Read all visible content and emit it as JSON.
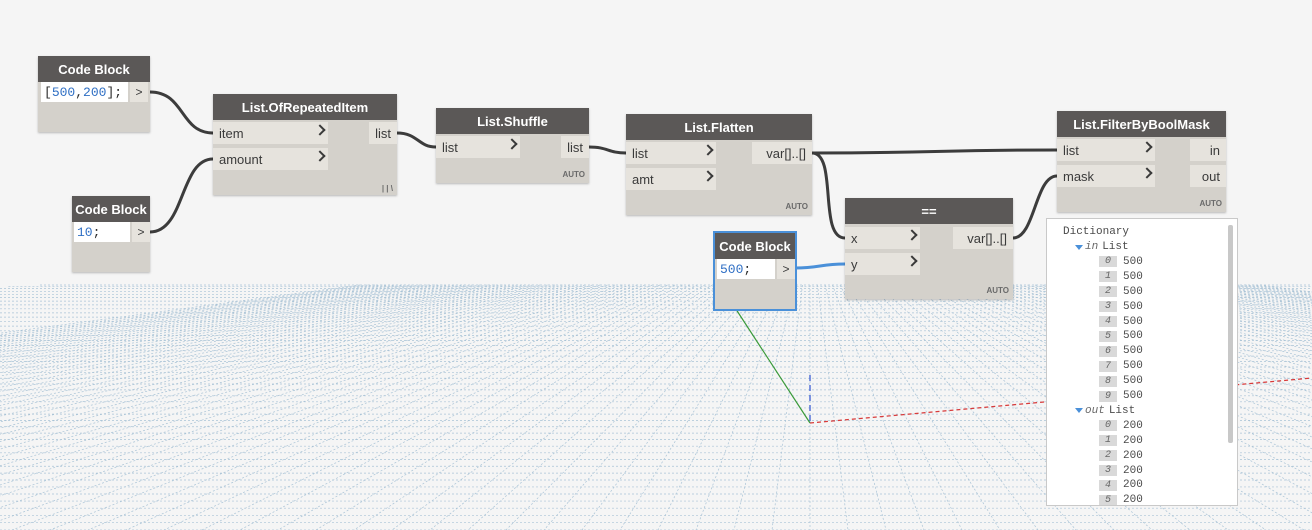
{
  "nodes": {
    "cb1": {
      "title": "Code Block",
      "code_open": "[",
      "code_a": "500",
      "code_sep": ",",
      "code_b": "200",
      "code_close": "];",
      "out": ">"
    },
    "cb2": {
      "title": "Code Block",
      "code_num": "10",
      "code_end": ";",
      "out": ">"
    },
    "cb3": {
      "title": "Code Block",
      "code_num": "500",
      "code_end": ";",
      "out": ">"
    },
    "repeat": {
      "title": "List.OfRepeatedItem",
      "inputs": [
        "item",
        "amount"
      ],
      "output": "list",
      "lacing": "| | \\"
    },
    "shuffle": {
      "title": "List.Shuffle",
      "inputs": [
        "list"
      ],
      "output": "list",
      "lacing": "AUTO"
    },
    "flatten": {
      "title": "List.Flatten",
      "inputs": [
        "list",
        "amt"
      ],
      "output": "var[]..[]",
      "lacing": "AUTO"
    },
    "equals": {
      "title": "==",
      "inputs": [
        "x",
        "y"
      ],
      "output": "var[]..[]",
      "lacing": "AUTO"
    },
    "filter": {
      "title": "List.FilterByBoolMask",
      "inputs": [
        "list",
        "mask"
      ],
      "outputs": [
        "in",
        "out"
      ],
      "lacing": "AUTO"
    }
  },
  "preview": {
    "root": "Dictionary",
    "groups": [
      {
        "key": "in",
        "type": "List",
        "items": [
          {
            "i": "0",
            "v": "500"
          },
          {
            "i": "1",
            "v": "500"
          },
          {
            "i": "2",
            "v": "500"
          },
          {
            "i": "3",
            "v": "500"
          },
          {
            "i": "4",
            "v": "500"
          },
          {
            "i": "5",
            "v": "500"
          },
          {
            "i": "6",
            "v": "500"
          },
          {
            "i": "7",
            "v": "500"
          },
          {
            "i": "8",
            "v": "500"
          },
          {
            "i": "9",
            "v": "500"
          }
        ]
      },
      {
        "key": "out",
        "type": "List",
        "items": [
          {
            "i": "0",
            "v": "200"
          },
          {
            "i": "1",
            "v": "200"
          },
          {
            "i": "2",
            "v": "200"
          },
          {
            "i": "3",
            "v": "200"
          },
          {
            "i": "4",
            "v": "200"
          },
          {
            "i": "5",
            "v": "200"
          }
        ]
      }
    ]
  },
  "colors": {
    "canvas": "#f5f5f5",
    "node_body": "#d4d1cb",
    "node_header": "#5b5857",
    "wire": "#3c3c3c",
    "selected_wire": "#4a90d9",
    "grid": "#a9c3d6",
    "number": "#2f6fc4"
  }
}
